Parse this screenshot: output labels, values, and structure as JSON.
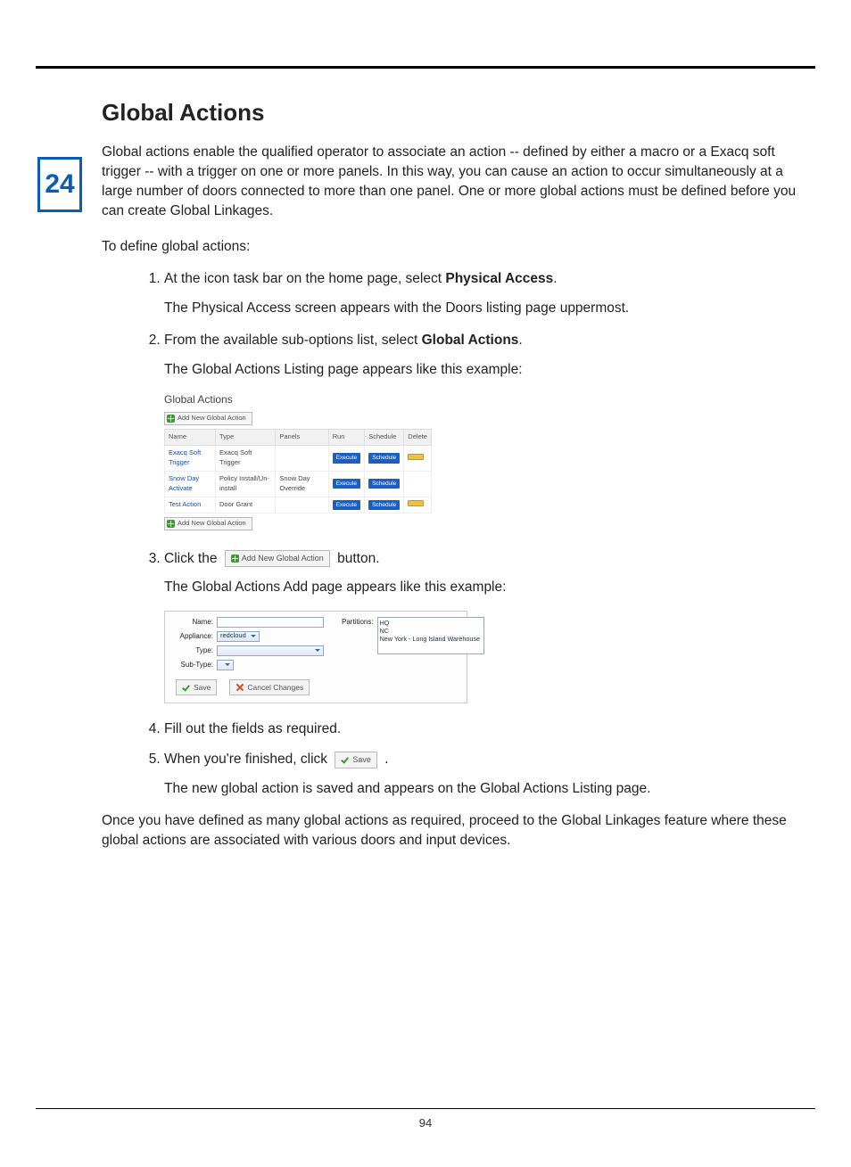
{
  "chapter_number": "24",
  "heading": "Global Actions",
  "intro": "Global actions enable the qualified operator to associate an action -- defined by either a macro or a Exacq soft trigger -- with a trigger on one or more panels. In this way, you can cause an action to occur simultaneously at a large number of doors connected to more than one panel. One or more global actions must be defined before you can create Global Linkages.",
  "to_define": "To define global actions:",
  "steps": {
    "s1a": "At the icon task bar on the home page, select ",
    "s1b": "Physical Access",
    "s1c": ".",
    "s1_note": "The Physical Access screen appears with the Doors listing page uppermost.",
    "s2a": "From the available sub-options list, select ",
    "s2b": "Global Actions",
    "s2c": ".",
    "s2_note": "The Global Actions Listing page appears like this example:",
    "s3a": "Click the  ",
    "s3b": "  button.",
    "s3_note": "The Global Actions Add page appears like this example:",
    "s4": "Fill out the fields as required.",
    "s5a": "When you're finished, click  ",
    "s5b": ".",
    "s5_note": "The new global action is saved and appears on the Global Actions Listing page."
  },
  "outro": "Once you have defined as many global actions as required, proceed to the Global Linkages feature where these global actions are associated with various doors and input devices.",
  "fig1": {
    "title": "Global Actions",
    "add_label": "Add New Global Action",
    "columns": [
      "Name",
      "Type",
      "Panels",
      "Run",
      "Schedule",
      "Delete"
    ],
    "rows": [
      {
        "name": "Exacq Soft Trigger",
        "type": "Exacq Soft Trigger",
        "panels": "",
        "run": "Execute",
        "sched": "Schedule",
        "del": true
      },
      {
        "name": "Snow Day Activate",
        "type": "Policy Install/Un-install",
        "panels": "Snow Day Override",
        "run": "Execute",
        "sched": "Schedule",
        "del": false
      },
      {
        "name": "Test Action",
        "type": "Door Grant",
        "panels": "",
        "run": "Execute",
        "sched": "Schedule",
        "del": true
      }
    ]
  },
  "inline_add_btn": "Add New Global Action",
  "fig2": {
    "labels": {
      "name": "Name:",
      "appliance": "Appliance:",
      "type": "Type:",
      "subtype": "Sub-Type:",
      "partitions": "Partitions:"
    },
    "appliance_value": "redcloud",
    "partitions": [
      "HQ",
      "NC",
      "New York - Long Island Warehouse"
    ],
    "save": "Save",
    "cancel": "Cancel Changes"
  },
  "inline_save_btn": "Save",
  "page_number": "94"
}
